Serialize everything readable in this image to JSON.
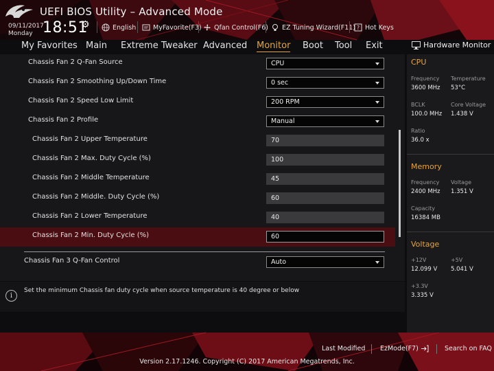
{
  "header": {
    "title": "UEFI BIOS Utility – Advanced Mode",
    "date": "09/11/2017",
    "day": "Monday",
    "time": "18:51",
    "buttons": [
      {
        "label": "English",
        "icon": "globe-icon"
      },
      {
        "label": "MyFavorite(F3)",
        "icon": "favorite-icon"
      },
      {
        "label": "Qfan Control(F6)",
        "icon": "fan-icon"
      },
      {
        "label": "EZ Tuning Wizard(F11)",
        "icon": "bulb-icon"
      },
      {
        "label": "Hot Keys",
        "icon": "help-key-icon"
      }
    ]
  },
  "menu": {
    "items": [
      "My Favorites",
      "Main",
      "Extreme Tweaker",
      "Advanced",
      "Monitor",
      "Boot",
      "Tool",
      "Exit"
    ],
    "active": "Monitor"
  },
  "settings": [
    {
      "label": "Chassis Fan 2 Q-Fan Source",
      "value": "CPU",
      "type": "dropdown"
    },
    {
      "label": "Chassis Fan 2 Smoothing Up/Down Time",
      "value": "0 sec",
      "type": "dropdown"
    },
    {
      "label": "Chassis Fan 2 Speed Low Limit",
      "value": "200 RPM",
      "type": "dropdown"
    },
    {
      "label": "Chassis Fan 2 Profile",
      "value": "Manual",
      "type": "dropdown"
    },
    {
      "label": "Chassis Fan 2 Upper Temperature",
      "value": "70",
      "type": "number"
    },
    {
      "label": "Chassis Fan 2 Max. Duty Cycle (%)",
      "value": "100",
      "type": "number"
    },
    {
      "label": "Chassis Fan 2 Middle Temperature",
      "value": "45",
      "type": "number"
    },
    {
      "label": "Chassis Fan 2 Middle. Duty Cycle (%)",
      "value": "60",
      "type": "number"
    },
    {
      "label": "Chassis Fan 2 Lower Temperature",
      "value": "40",
      "type": "number"
    },
    {
      "label": "Chassis Fan 2 Min. Duty Cycle (%)",
      "value": "60",
      "type": "number",
      "selected": true
    },
    {
      "label": "Chassis Fan 3 Q-Fan Control",
      "value": "Auto",
      "type": "dropdown"
    }
  ],
  "help": {
    "text": "Set the minimum Chassis fan duty cycle when source temperature is 40 degree or below"
  },
  "hardware_monitor": {
    "title": "Hardware Monitor",
    "cpu": {
      "heading": "CPU",
      "frequency_label": "Frequency",
      "frequency": "3600 MHz",
      "temperature_label": "Temperature",
      "temperature": "53°C",
      "bclk_label": "BCLK",
      "bclk": "100.0 MHz",
      "core_voltage_label": "Core Voltage",
      "core_voltage": "1.438 V",
      "ratio_label": "Ratio",
      "ratio": "36.0 x"
    },
    "memory": {
      "heading": "Memory",
      "frequency_label": "Frequency",
      "frequency": "2400 MHz",
      "voltage_label": "Voltage",
      "voltage": "1.351 V",
      "capacity_label": "Capacity",
      "capacity": "16384 MB"
    },
    "voltage": {
      "heading": "Voltage",
      "v12_label": "+12V",
      "v12": "12.099 V",
      "v5_label": "+5V",
      "v5": "5.041 V",
      "v33_label": "+3.3V",
      "v33": "3.335 V"
    }
  },
  "footer": {
    "last_modified": "Last Modified",
    "ezmode": "EzMode(F7)",
    "search": "Search on FAQ",
    "copyright": "Version 2.17.1246. Copyright (C) 2017 American Megatrends, Inc."
  },
  "colors": {
    "accent": "#e8a53a",
    "selected_row": "#4a0d12",
    "brand_red": "#8a0f18"
  }
}
